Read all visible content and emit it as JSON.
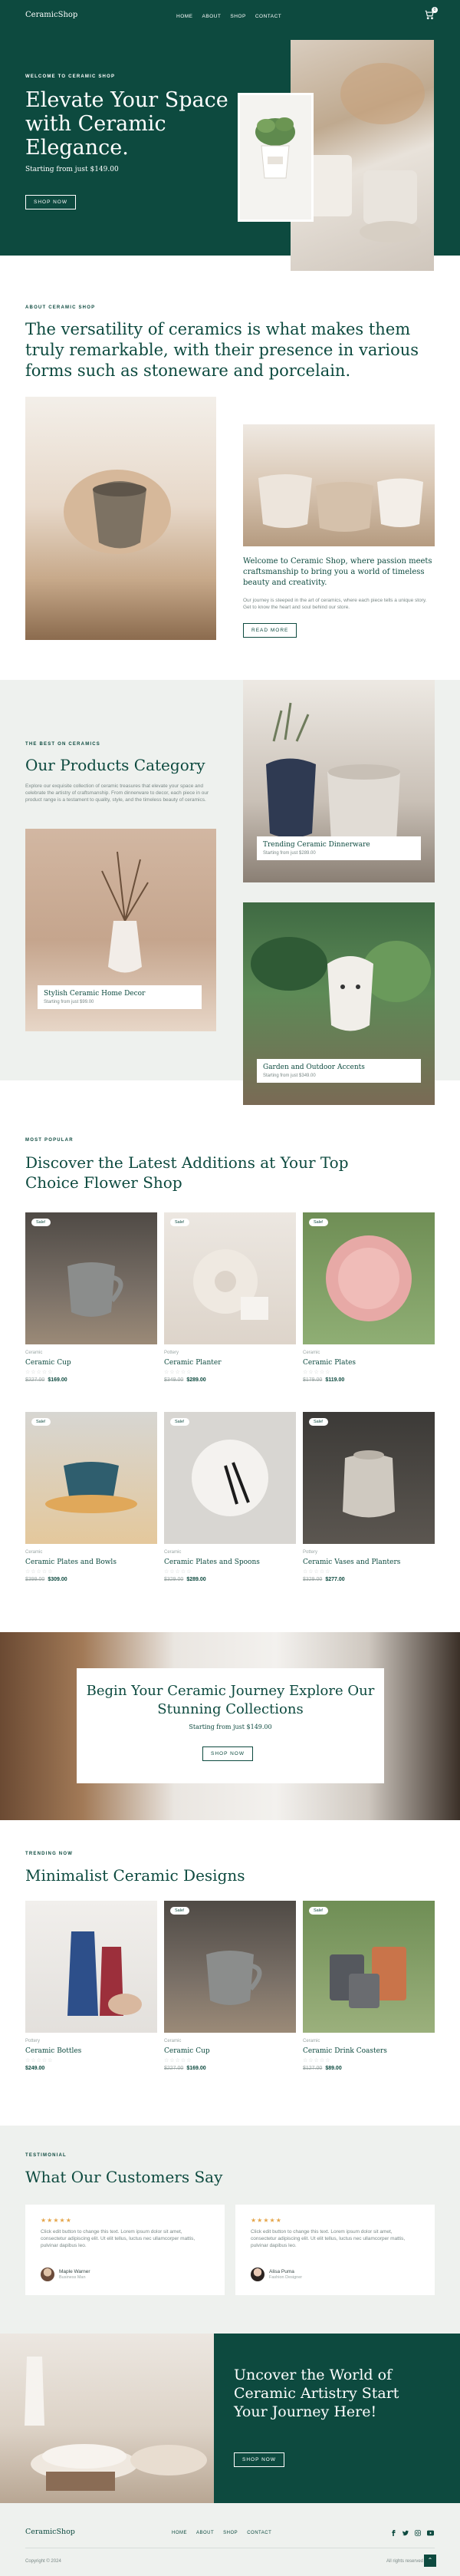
{
  "brand": {
    "logo": "CeramicShop"
  },
  "nav": {
    "items": [
      "HOME",
      "ABOUT",
      "SHOP",
      "CONTACT"
    ],
    "cart_count": "0"
  },
  "hero": {
    "eyebrow": "WELCOME TO CERAMIC SHOP",
    "title": "Elevate Your Space with Ceramic Elegance.",
    "subtitle": "Starting from just $149.00",
    "button": "SHOP NOW"
  },
  "about": {
    "eyebrow": "ABOUT CERAMIC SHOP",
    "headline": "The versatility of ceramics is what makes them truly remarkable, with their presence in various forms such as stoneware and porcelain.",
    "card_title": "Welcome to Ceramic Shop, where passion meets craftsmanship to bring you a world of timeless beauty and creativity.",
    "card_body": "Our journey is steeped in the art of ceramics, where each piece tells a unique story. Get to know the heart and soul behind our store.",
    "button": "READ MORE"
  },
  "categories": {
    "eyebrow": "THE BEST ON CERAMICS",
    "title": "Our Products Category",
    "body": "Explore our exquisite collection of ceramic treasures that elevate your space and celebrate the artistry of craftsmanship. From dinnerware to decor, each piece in our product range is a testament to quality, style, and the timeless beauty of ceramics.",
    "items": [
      {
        "title": "Trending Ceramic Dinnerware",
        "subtitle": "Starting from just $289.00"
      },
      {
        "title": "Stylish Ceramic Home Decor",
        "subtitle": "Starting from just $99.00"
      },
      {
        "title": "Garden and Outdoor Accents",
        "subtitle": "Starting from just $349.00"
      }
    ]
  },
  "latest": {
    "eyebrow": "MOST POPULAR",
    "title": "Discover the Latest Additions at Your Top Choice Flower Shop",
    "products": [
      {
        "badge": "Sale!",
        "category": "Ceramic",
        "name": "Ceramic Cup",
        "stars": "☆☆☆☆☆",
        "old_price": "$227.00",
        "price": "$169.00"
      },
      {
        "badge": "Sale!",
        "category": "Pottery",
        "name": "Ceramic Planter",
        "stars": "☆☆☆☆☆",
        "old_price": "$349.00",
        "price": "$289.00"
      },
      {
        "badge": "Sale!",
        "category": "Ceramic",
        "name": "Ceramic Plates",
        "stars": "☆☆☆☆☆",
        "old_price": "$179.00",
        "price": "$119.00"
      },
      {
        "badge": "Sale!",
        "category": "Ceramic",
        "name": "Ceramic Plates and Bowls",
        "stars": "☆☆☆☆☆",
        "old_price": "$399.00",
        "price": "$309.00"
      },
      {
        "badge": "Sale!",
        "category": "Ceramic",
        "name": "Ceramic Plates and Spoons",
        "stars": "☆☆☆☆☆",
        "old_price": "$329.00",
        "price": "$289.00"
      },
      {
        "badge": "Sale!",
        "category": "Pottery",
        "name": "Ceramic Vases and Planters",
        "stars": "☆☆☆☆☆",
        "old_price": "$329.00",
        "price": "$277.00"
      }
    ]
  },
  "banner": {
    "title": "Begin Your Ceramic Journey Explore Our Stunning Collections",
    "subtitle": "Starting from just $149.00",
    "button": "SHOP NOW"
  },
  "minimalist": {
    "eyebrow": "TRENDING NOW",
    "title": "Minimalist Ceramic Designs",
    "products": [
      {
        "badge": "",
        "category": "Pottery",
        "name": "Ceramic Bottles",
        "stars": "☆☆☆☆☆",
        "old_price": "",
        "price": "$249.00"
      },
      {
        "badge": "Sale!",
        "category": "Ceramic",
        "name": "Ceramic Cup",
        "stars": "☆☆☆☆☆",
        "old_price": "$227.00",
        "price": "$169.00"
      },
      {
        "badge": "Sale!",
        "category": "Ceramic",
        "name": "Ceramic Drink Coasters",
        "stars": "☆☆☆☆☆",
        "old_price": "$127.00",
        "price": "$89.00"
      }
    ]
  },
  "testimonials": {
    "eyebrow": "TESTIMONIAL",
    "title": "What Our Customers Say",
    "items": [
      {
        "stars": "★★★★★",
        "quote": "Click edit button to change this text. Lorem ipsum dolor sit amet, consectetur adipiscing elit. Ut elit tellus, luctus nec ullamcorper mattis, pulvinar dapibus leo.",
        "name": "Maple Warner",
        "role": "Business Man"
      },
      {
        "stars": "★★★★★",
        "quote": "Click edit button to change this text. Lorem ipsum dolor sit amet, consectetur adipiscing elit. Ut elit tellus, luctus nec ullamcorper mattis, pulvinar dapibus leo.",
        "name": "Alisa Puma",
        "role": "Fashion Designer"
      }
    ]
  },
  "cta": {
    "title": "Uncover the World of Ceramic Artistry Start Your Journey Here!",
    "button": "SHOP NOW"
  },
  "footer": {
    "logo": "CeramicShop",
    "menu": [
      "HOME",
      "ABOUT",
      "SHOP",
      "CONTACT"
    ],
    "copyright": "Copyright © 2024",
    "rights": "All rights reserved"
  },
  "colors": {
    "brand_green": "#0d4a3f",
    "light_bg": "#eef1ee",
    "star_gold": "#e5a54a"
  }
}
